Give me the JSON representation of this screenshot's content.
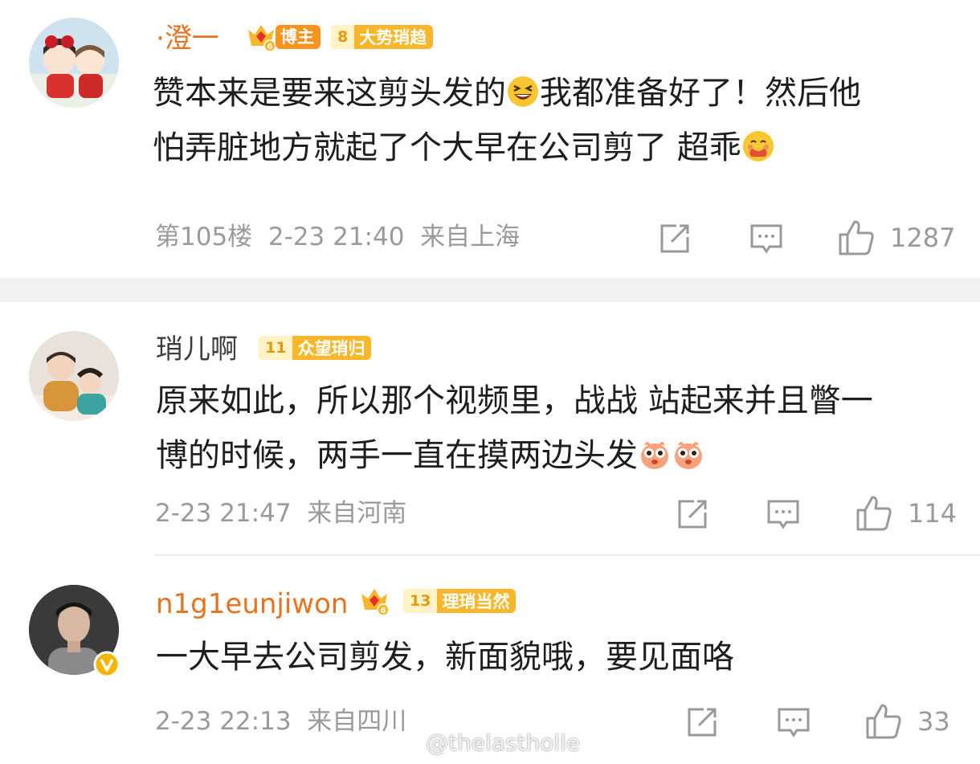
{
  "comments": [
    {
      "username": "·澄一",
      "badges": [
        "博主",
        "8",
        "大势琑趋"
      ],
      "text_line1": "赞本来是要来这剪头发的",
      "text_line1b": "我都准备好了！然后他",
      "text_line2": "怕弄脏地方就起了个大早在公司剪了 超乖",
      "floor": "第105楼",
      "time": "2-23 21:40",
      "location": "来自上海",
      "likes": "1287"
    },
    {
      "username": "琑儿啊",
      "badges": [
        "11",
        "众望琑归"
      ],
      "text_line1": "原来如此，所以那个视频里，战战 站起来并且瞥一",
      "text_line2": "博的时候，两手一直在摸两边头发",
      "time": "2-23 21:47",
      "location": "来自河南",
      "likes": "114"
    },
    {
      "username": "n1g1eunjiwon",
      "badges": [
        "13",
        "理琑当然"
      ],
      "text_line1": "一大早去公司剪发，新面貌哦，要见面咯",
      "time": "2-23 22:13",
      "location": "来自四川",
      "likes": "33"
    }
  ],
  "watermark": "@thelastholle",
  "icons": [
    "repost-icon",
    "comment-icon",
    "like-icon",
    "vip-crown-icon",
    "grin-emoji",
    "hug-emoji",
    "rabbit-emoji",
    "verified-icon",
    "weibo-logo"
  ],
  "colors": {
    "username_vip": "#e8731e",
    "badge_gold": "#f8b72a",
    "meta_gray": "#9a9a9a"
  }
}
